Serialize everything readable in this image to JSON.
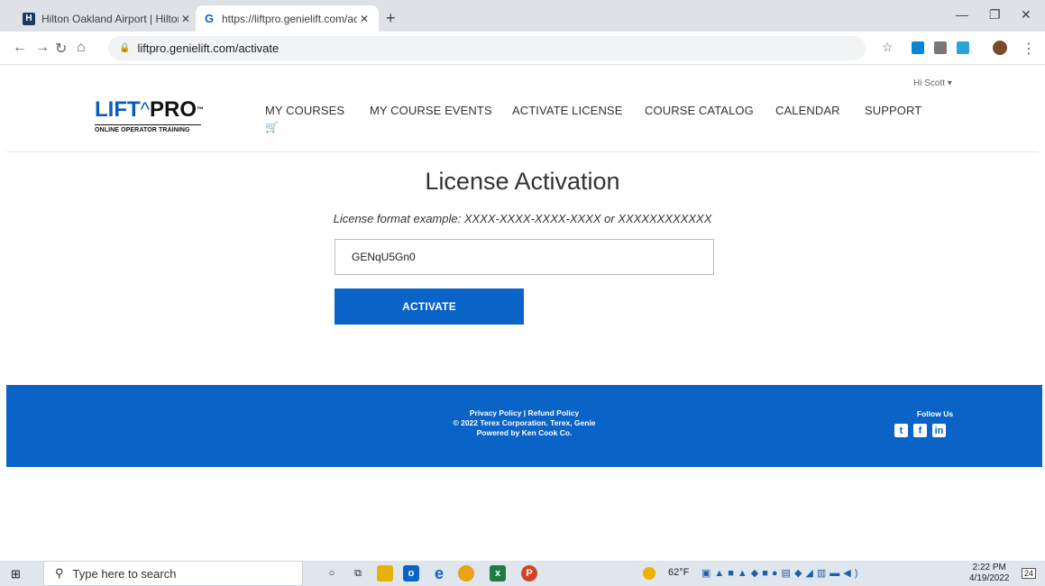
{
  "browser": {
    "tabs": [
      {
        "title": "Hilton Oakland Airport | Hilton W",
        "close": "✕"
      },
      {
        "title": "https://liftpro.genielift.com/activ",
        "close": "✕"
      }
    ],
    "new_tab": "+",
    "url": "liftpro.genielift.com/activate"
  },
  "header": {
    "logo_lift": "LIFT",
    "logo_caret": "^",
    "logo_pro": "PRO",
    "logo_tm": "™",
    "logo_subtitle": "ONLINE OPERATOR TRAINING",
    "greeting": "Hi Scott ▾",
    "nav": [
      "MY COURSES",
      "MY COURSE EVENTS",
      "ACTIVATE LICENSE",
      "COURSE CATALOG",
      "CALENDAR",
      "SUPPORT"
    ]
  },
  "main": {
    "title": "License Activation",
    "format_hint": "License format example: XXXX-XXXX-XXXX-XXXX or XXXXXXXXXXXX",
    "license_value": "GENqU5Gn0",
    "activate_label": "ACTIVATE"
  },
  "footer": {
    "links": "Privacy Policy | Refund Policy",
    "copyright": "© 2022 Terex Corporation. Terex, Genie",
    "powered": "Powered by Ken Cook Co.",
    "follow": "Follow Us",
    "social": [
      "twitter-icon",
      "facebook-icon",
      "linkedin-icon"
    ]
  },
  "taskbar": {
    "search_placeholder": "Type here to search",
    "weather": "62°F",
    "time": "2:22 PM",
    "date": "4/19/2022",
    "notifications": "24"
  }
}
